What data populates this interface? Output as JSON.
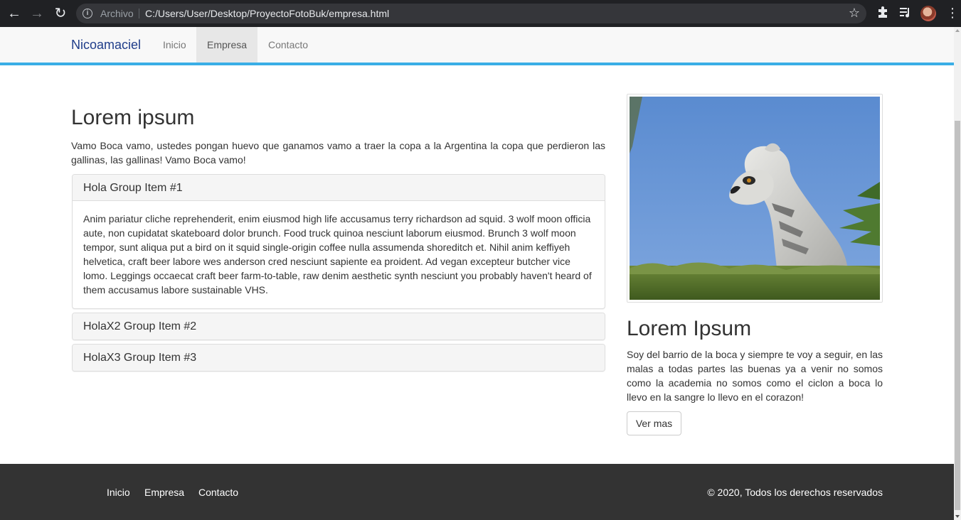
{
  "browser": {
    "scheme_label": "Archivo",
    "url": "C:/Users/User/Desktop/ProyectoFotoBuk/empresa.html"
  },
  "navbar": {
    "brand": "Nicoamaciel",
    "links": [
      {
        "label": "Inicio",
        "active": false
      },
      {
        "label": "Empresa",
        "active": true
      },
      {
        "label": "Contacto",
        "active": false
      }
    ],
    "accent_color": "#3aaee6"
  },
  "main": {
    "title": "Lorem ipsum",
    "intro": "Vamo Boca vamo, ustedes pongan huevo que ganamos vamo a traer la copa a la Argentina la copa que perdieron las gallinas, las gallinas! Vamo Boca vamo!",
    "accordion": [
      {
        "heading": "Hola Group Item #1",
        "expanded": true,
        "body": "Anim pariatur cliche reprehenderit, enim eiusmod high life accusamus terry richardson ad squid. 3 wolf moon officia aute, non cupidatat skateboard dolor brunch. Food truck quinoa nesciunt laborum eiusmod. Brunch 3 wolf moon tempor, sunt aliqua put a bird on it squid single-origin coffee nulla assumenda shoreditch et. Nihil anim keffiyeh helvetica, craft beer labore wes anderson cred nesciunt sapiente ea proident. Ad vegan excepteur butcher vice lomo. Leggings occaecat craft beer farm-to-table, raw denim aesthetic synth nesciunt you probably haven't heard of them accusamus labore sustainable VHS."
      },
      {
        "heading": "HolaX2 Group Item #2",
        "expanded": false
      },
      {
        "heading": "HolaX3 Group Item #3",
        "expanded": false
      }
    ]
  },
  "sidebar": {
    "image_subject": "ring-tailed lemur sitting on grass",
    "title": "Lorem Ipsum",
    "text": "Soy del barrio de la boca y siempre te voy a seguir, en las malas a todas partes las buenas ya a venir no somos como la academia no somos como el ciclon a boca lo llevo en la sangre lo llevo en el corazon!",
    "button_label": "Ver mas"
  },
  "footer": {
    "links": [
      "Inicio",
      "Empresa",
      "Contacto"
    ],
    "copyright": "© 2020, Todos los derechos reservados"
  }
}
